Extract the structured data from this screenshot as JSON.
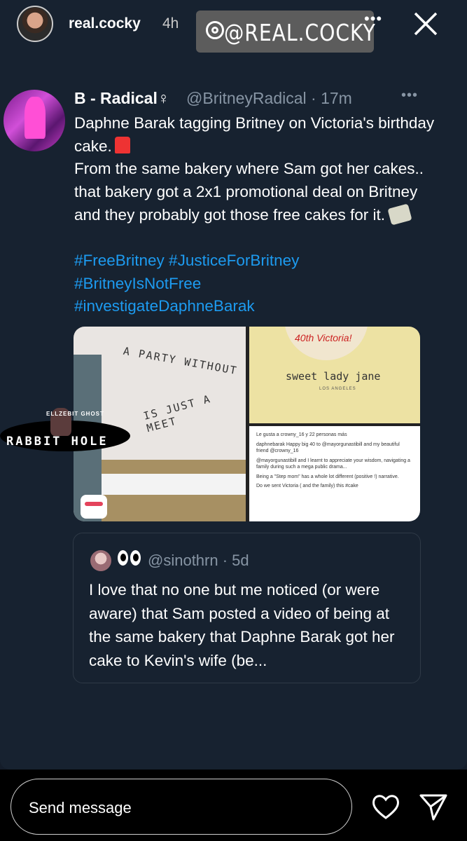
{
  "story": {
    "username": "real.cocky",
    "time": "4h",
    "tag": "@REAL.COCKY"
  },
  "tweet": {
    "name": "B - Radical♀",
    "handle": "@BritneyRadical · 17m",
    "text1": "Daphne Barak tagging Britney on Victoria's birthday cake.",
    "text2": "From the same bakery where Sam got her cakes.. that bakery got a 2x1 promotional deal on Britney and they probably got those free cakes for it.",
    "hashtags": [
      "#FreeBritney #JusticeForBritney",
      "#BritneyIsNotFree",
      "#investigateDaphneBarak"
    ]
  },
  "media": {
    "wall_text_1": "A PARTY WITHOUT",
    "wall_text_2": "IS JUST A MEET",
    "cake_text": "40th Victoria!",
    "bakery": "sweet lady jane",
    "bakery_sub": "LOS ANGELES",
    "post_likes": "Le gusta a crowny_16 y 22 personas más",
    "post_text_1": "daphnebarak Happy big 40 to @mayorgunastibill and my beautiful friend @crowny_16",
    "post_text_2": "@mayorgunastibill and I learnt to appreciate your wisdom, navigating a family during such a mega public drama...",
    "post_text_3": "Being a \"Step mom\" has a whole lot different (positive !) narrative.",
    "post_text_4": "Do we sent Victoria ( and the family) this #cake"
  },
  "sticker": {
    "top_text": "ELLZEBIT GHOST",
    "label": "RABBIT HOLE"
  },
  "quote": {
    "handle": "@sinothrn · 5d",
    "text": "I love that no one but me noticed (or were aware) that Sam posted a video of being at the same bakery that Daphne Barak got her cake to Kevin's wife (be..."
  },
  "footer": {
    "placeholder": "Send message"
  },
  "icons": {
    "more": "more-icon",
    "close": "close-icon",
    "heart": "heart-icon",
    "send": "send-icon"
  }
}
